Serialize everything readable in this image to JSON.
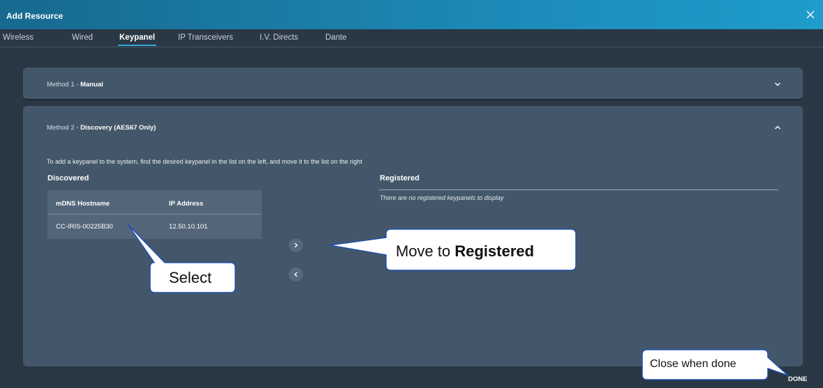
{
  "dialog": {
    "title": "Add Resource",
    "close_icon": "close-icon"
  },
  "tabs": [
    {
      "label": "Wireless",
      "active": false
    },
    {
      "label": "Wired",
      "active": false
    },
    {
      "label": "Keypanel",
      "active": true
    },
    {
      "label": "IP Transceivers",
      "active": false
    },
    {
      "label": "I.V. Directs",
      "active": false
    },
    {
      "label": "Dante",
      "active": false
    }
  ],
  "method1": {
    "label": "Method 1 -",
    "value": "Manual",
    "toggle_icon": "chevron-down-icon"
  },
  "method2": {
    "label": "Method 2 -",
    "value": "Discovery (AES67 Only)",
    "toggle_icon": "chevron-up-icon",
    "instructions": "To add a keypanel to the system, find the desired keypanel in the list on the left, and move it to the list on the right",
    "discovered": {
      "title": "Discovered",
      "columns": [
        "mDNS Hostname",
        "IP Address"
      ],
      "rows": [
        [
          "CC-IRIS-00225B30",
          "12.50.10.101"
        ]
      ]
    },
    "registered": {
      "title": "Registered",
      "empty_text": "There are no registered keypanels to display"
    },
    "buttons": {
      "move_right_icon": "chevron-right-icon",
      "move_left_icon": "chevron-left-icon"
    }
  },
  "footer": {
    "done_label": "DONE"
  },
  "callouts": {
    "select": "Select",
    "move_prefix": "Move to ",
    "move_bold": "Registered",
    "close": "Close when done"
  },
  "colors": {
    "titlebar": "#1a7ca6",
    "background": "#2a3744",
    "panel": "#44576a",
    "table": "#536679",
    "accent": "#31a7d9",
    "callout_fill": "#ffffff",
    "callout_border": "#1f4fb0"
  }
}
